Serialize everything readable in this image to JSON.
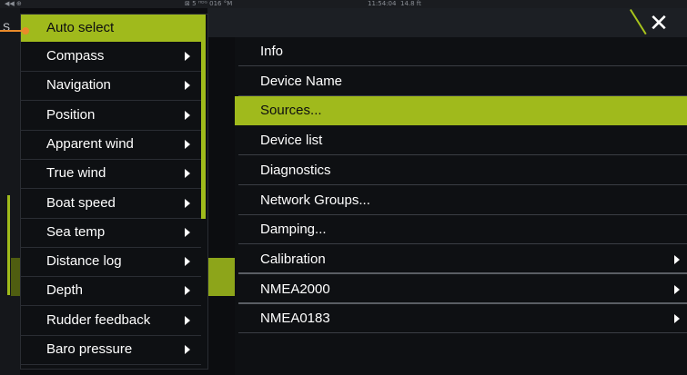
{
  "status_bar": {
    "left": "◀◀ ⊕",
    "middle": "⊠ 5 ᴴᴰᴳ 016 °M",
    "time": "11:54:04",
    "depth": "14.8 ft"
  },
  "background": {
    "left_label": "S"
  },
  "close_label": "✕",
  "left_menu": {
    "items": [
      {
        "label": "Auto select",
        "selected": true,
        "has_arrow": false
      },
      {
        "label": "Compass",
        "has_arrow": true
      },
      {
        "label": "Navigation",
        "has_arrow": true
      },
      {
        "label": "Position",
        "has_arrow": true
      },
      {
        "label": "Apparent wind",
        "has_arrow": true
      },
      {
        "label": "True wind",
        "has_arrow": true
      },
      {
        "label": "Boat speed",
        "has_arrow": true
      },
      {
        "label": "Sea temp",
        "has_arrow": true
      },
      {
        "label": "Distance log",
        "has_arrow": true
      },
      {
        "label": "Depth",
        "has_arrow": true
      },
      {
        "label": "Rudder feedback",
        "has_arrow": true
      },
      {
        "label": "Baro pressure",
        "has_arrow": true
      }
    ]
  },
  "right_menu": {
    "items": [
      {
        "label": "Info",
        "has_arrow": false
      },
      {
        "label": "Device Name",
        "has_arrow": false
      },
      {
        "label": "Sources...",
        "selected": true,
        "has_arrow": false
      },
      {
        "label": "Device list",
        "has_arrow": false
      },
      {
        "label": "Diagnostics",
        "has_arrow": false
      },
      {
        "label": "Network Groups...",
        "has_arrow": false
      },
      {
        "label": "Damping...",
        "has_arrow": false
      },
      {
        "label": "Calibration",
        "has_arrow": true
      },
      {
        "label": "NMEA2000",
        "has_arrow": true
      },
      {
        "label": "NMEA0183",
        "has_arrow": true
      }
    ]
  },
  "colors": {
    "accent": "#a0ba1c",
    "pointer": "#e98a2a",
    "background": "#0e1013"
  }
}
